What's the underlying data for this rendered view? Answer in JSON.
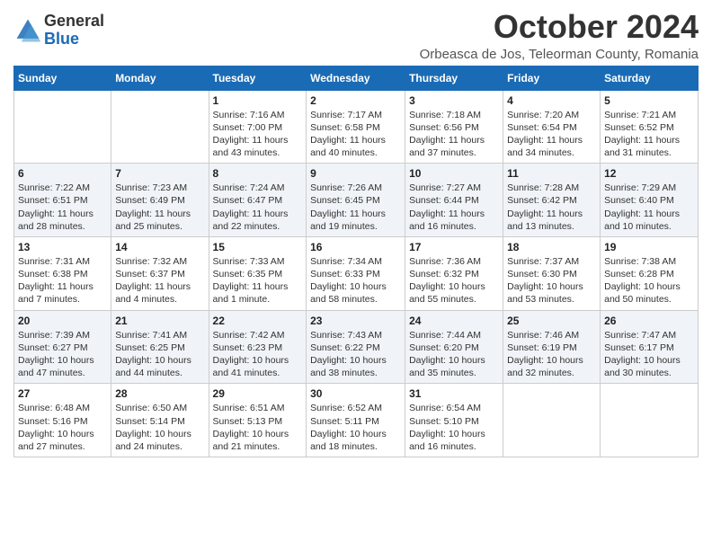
{
  "header": {
    "logo_general": "General",
    "logo_blue": "Blue",
    "month_title": "October 2024",
    "location": "Orbeasca de Jos, Teleorman County, Romania"
  },
  "days_of_week": [
    "Sunday",
    "Monday",
    "Tuesday",
    "Wednesday",
    "Thursday",
    "Friday",
    "Saturday"
  ],
  "weeks": [
    [
      {
        "day": "",
        "sunrise": "",
        "sunset": "",
        "daylight": ""
      },
      {
        "day": "",
        "sunrise": "",
        "sunset": "",
        "daylight": ""
      },
      {
        "day": "1",
        "sunrise": "Sunrise: 7:16 AM",
        "sunset": "Sunset: 7:00 PM",
        "daylight": "Daylight: 11 hours and 43 minutes."
      },
      {
        "day": "2",
        "sunrise": "Sunrise: 7:17 AM",
        "sunset": "Sunset: 6:58 PM",
        "daylight": "Daylight: 11 hours and 40 minutes."
      },
      {
        "day": "3",
        "sunrise": "Sunrise: 7:18 AM",
        "sunset": "Sunset: 6:56 PM",
        "daylight": "Daylight: 11 hours and 37 minutes."
      },
      {
        "day": "4",
        "sunrise": "Sunrise: 7:20 AM",
        "sunset": "Sunset: 6:54 PM",
        "daylight": "Daylight: 11 hours and 34 minutes."
      },
      {
        "day": "5",
        "sunrise": "Sunrise: 7:21 AM",
        "sunset": "Sunset: 6:52 PM",
        "daylight": "Daylight: 11 hours and 31 minutes."
      }
    ],
    [
      {
        "day": "6",
        "sunrise": "Sunrise: 7:22 AM",
        "sunset": "Sunset: 6:51 PM",
        "daylight": "Daylight: 11 hours and 28 minutes."
      },
      {
        "day": "7",
        "sunrise": "Sunrise: 7:23 AM",
        "sunset": "Sunset: 6:49 PM",
        "daylight": "Daylight: 11 hours and 25 minutes."
      },
      {
        "day": "8",
        "sunrise": "Sunrise: 7:24 AM",
        "sunset": "Sunset: 6:47 PM",
        "daylight": "Daylight: 11 hours and 22 minutes."
      },
      {
        "day": "9",
        "sunrise": "Sunrise: 7:26 AM",
        "sunset": "Sunset: 6:45 PM",
        "daylight": "Daylight: 11 hours and 19 minutes."
      },
      {
        "day": "10",
        "sunrise": "Sunrise: 7:27 AM",
        "sunset": "Sunset: 6:44 PM",
        "daylight": "Daylight: 11 hours and 16 minutes."
      },
      {
        "day": "11",
        "sunrise": "Sunrise: 7:28 AM",
        "sunset": "Sunset: 6:42 PM",
        "daylight": "Daylight: 11 hours and 13 minutes."
      },
      {
        "day": "12",
        "sunrise": "Sunrise: 7:29 AM",
        "sunset": "Sunset: 6:40 PM",
        "daylight": "Daylight: 11 hours and 10 minutes."
      }
    ],
    [
      {
        "day": "13",
        "sunrise": "Sunrise: 7:31 AM",
        "sunset": "Sunset: 6:38 PM",
        "daylight": "Daylight: 11 hours and 7 minutes."
      },
      {
        "day": "14",
        "sunrise": "Sunrise: 7:32 AM",
        "sunset": "Sunset: 6:37 PM",
        "daylight": "Daylight: 11 hours and 4 minutes."
      },
      {
        "day": "15",
        "sunrise": "Sunrise: 7:33 AM",
        "sunset": "Sunset: 6:35 PM",
        "daylight": "Daylight: 11 hours and 1 minute."
      },
      {
        "day": "16",
        "sunrise": "Sunrise: 7:34 AM",
        "sunset": "Sunset: 6:33 PM",
        "daylight": "Daylight: 10 hours and 58 minutes."
      },
      {
        "day": "17",
        "sunrise": "Sunrise: 7:36 AM",
        "sunset": "Sunset: 6:32 PM",
        "daylight": "Daylight: 10 hours and 55 minutes."
      },
      {
        "day": "18",
        "sunrise": "Sunrise: 7:37 AM",
        "sunset": "Sunset: 6:30 PM",
        "daylight": "Daylight: 10 hours and 53 minutes."
      },
      {
        "day": "19",
        "sunrise": "Sunrise: 7:38 AM",
        "sunset": "Sunset: 6:28 PM",
        "daylight": "Daylight: 10 hours and 50 minutes."
      }
    ],
    [
      {
        "day": "20",
        "sunrise": "Sunrise: 7:39 AM",
        "sunset": "Sunset: 6:27 PM",
        "daylight": "Daylight: 10 hours and 47 minutes."
      },
      {
        "day": "21",
        "sunrise": "Sunrise: 7:41 AM",
        "sunset": "Sunset: 6:25 PM",
        "daylight": "Daylight: 10 hours and 44 minutes."
      },
      {
        "day": "22",
        "sunrise": "Sunrise: 7:42 AM",
        "sunset": "Sunset: 6:23 PM",
        "daylight": "Daylight: 10 hours and 41 minutes."
      },
      {
        "day": "23",
        "sunrise": "Sunrise: 7:43 AM",
        "sunset": "Sunset: 6:22 PM",
        "daylight": "Daylight: 10 hours and 38 minutes."
      },
      {
        "day": "24",
        "sunrise": "Sunrise: 7:44 AM",
        "sunset": "Sunset: 6:20 PM",
        "daylight": "Daylight: 10 hours and 35 minutes."
      },
      {
        "day": "25",
        "sunrise": "Sunrise: 7:46 AM",
        "sunset": "Sunset: 6:19 PM",
        "daylight": "Daylight: 10 hours and 32 minutes."
      },
      {
        "day": "26",
        "sunrise": "Sunrise: 7:47 AM",
        "sunset": "Sunset: 6:17 PM",
        "daylight": "Daylight: 10 hours and 30 minutes."
      }
    ],
    [
      {
        "day": "27",
        "sunrise": "Sunrise: 6:48 AM",
        "sunset": "Sunset: 5:16 PM",
        "daylight": "Daylight: 10 hours and 27 minutes."
      },
      {
        "day": "28",
        "sunrise": "Sunrise: 6:50 AM",
        "sunset": "Sunset: 5:14 PM",
        "daylight": "Daylight: 10 hours and 24 minutes."
      },
      {
        "day": "29",
        "sunrise": "Sunrise: 6:51 AM",
        "sunset": "Sunset: 5:13 PM",
        "daylight": "Daylight: 10 hours and 21 minutes."
      },
      {
        "day": "30",
        "sunrise": "Sunrise: 6:52 AM",
        "sunset": "Sunset: 5:11 PM",
        "daylight": "Daylight: 10 hours and 18 minutes."
      },
      {
        "day": "31",
        "sunrise": "Sunrise: 6:54 AM",
        "sunset": "Sunset: 5:10 PM",
        "daylight": "Daylight: 10 hours and 16 minutes."
      },
      {
        "day": "",
        "sunrise": "",
        "sunset": "",
        "daylight": ""
      },
      {
        "day": "",
        "sunrise": "",
        "sunset": "",
        "daylight": ""
      }
    ]
  ]
}
